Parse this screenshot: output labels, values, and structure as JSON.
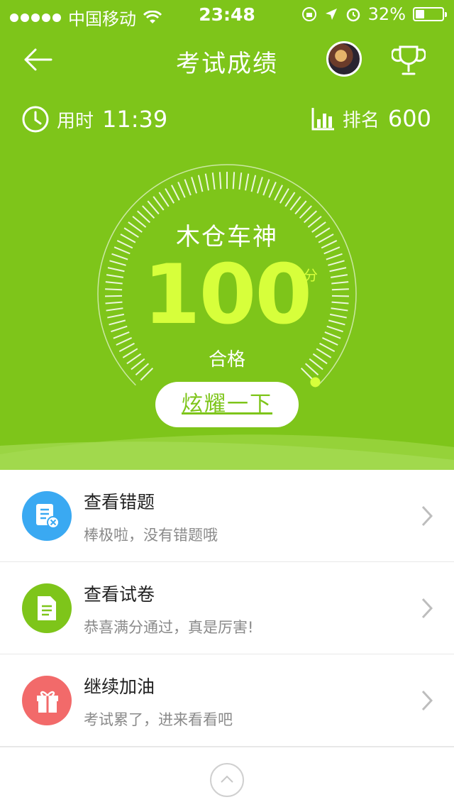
{
  "status_bar": {
    "carrier": "中国移动",
    "time": "23:48",
    "battery": "32%",
    "battery_level": 0.32
  },
  "nav": {
    "title": "考试成绩"
  },
  "stats": {
    "time_label": "用时",
    "time_value": "11:39",
    "rank_label": "排名",
    "rank_value": "600"
  },
  "score": {
    "title": "木仓车神",
    "value": "100",
    "unit": "分",
    "status": "合格"
  },
  "share_button": "炫耀一下",
  "list": [
    {
      "title": "查看错题",
      "subtitle": "棒极啦，没有错题哦",
      "icon": "wrong-questions-icon",
      "color": "#3aa9f2"
    },
    {
      "title": "查看试卷",
      "subtitle": "恭喜满分通过，真是厉害!",
      "icon": "document-icon",
      "color": "#7ec51a"
    },
    {
      "title": "继续加油",
      "subtitle": "考试累了，进来看看吧",
      "icon": "gift-icon",
      "color": "#f26a6a"
    }
  ],
  "colors": {
    "brand_green": "#7ec51a",
    "score_yellow": "#d7ff3b"
  }
}
